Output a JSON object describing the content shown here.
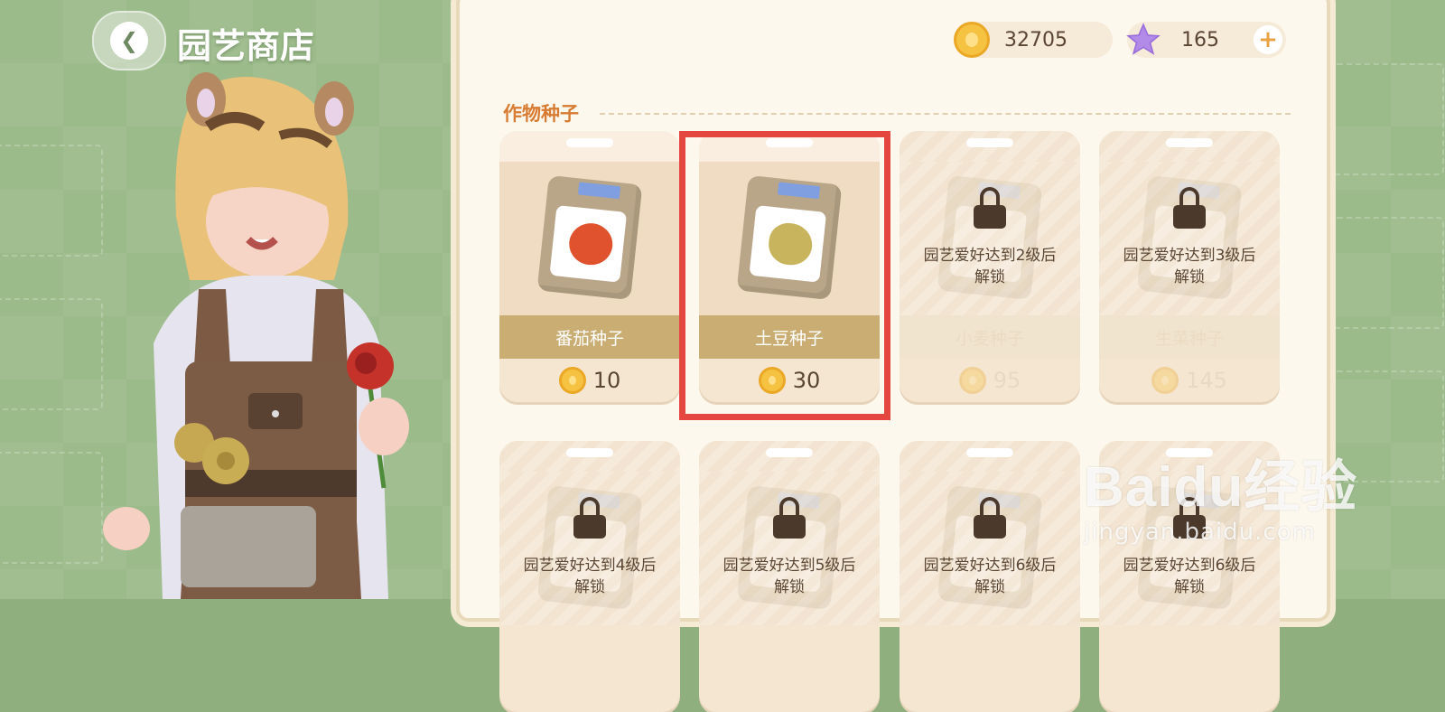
{
  "header": {
    "title": "园艺商店",
    "back_icon": "chevron-left-icon"
  },
  "currencies": {
    "coins": "32705",
    "stars": "165",
    "add_label": "+"
  },
  "section": {
    "title": "作物种子"
  },
  "items": [
    {
      "name": "番茄种子",
      "price": "10",
      "locked": false,
      "lock_text": "",
      "fruit_color": "#e0522e"
    },
    {
      "name": "土豆种子",
      "price": "30",
      "locked": false,
      "lock_text": "",
      "fruit_color": "#c9b45e"
    },
    {
      "name": "小麦种子",
      "price": "95",
      "locked": true,
      "lock_text": "园艺爱好达到2级后\n解锁"
    },
    {
      "name": "生菜种子",
      "price": "145",
      "locked": true,
      "lock_text": "园艺爱好达到3级后\n解锁"
    },
    {
      "name": "",
      "price": "",
      "locked": true,
      "lock_text": "园艺爱好达到4级后\n解锁"
    },
    {
      "name": "",
      "price": "",
      "locked": true,
      "lock_text": "园艺爱好达到5级后\n解锁"
    },
    {
      "name": "",
      "price": "",
      "locked": true,
      "lock_text": "园艺爱好达到6级后\n解锁"
    },
    {
      "name": "",
      "price": "",
      "locked": true,
      "lock_text": "园艺爱好达到6级后\n解锁"
    }
  ],
  "watermark": {
    "main": "Baidu经验",
    "sub": "jingyan.baidu.com"
  },
  "colors": {
    "highlight": "#e64640",
    "accent": "#d77c32"
  }
}
